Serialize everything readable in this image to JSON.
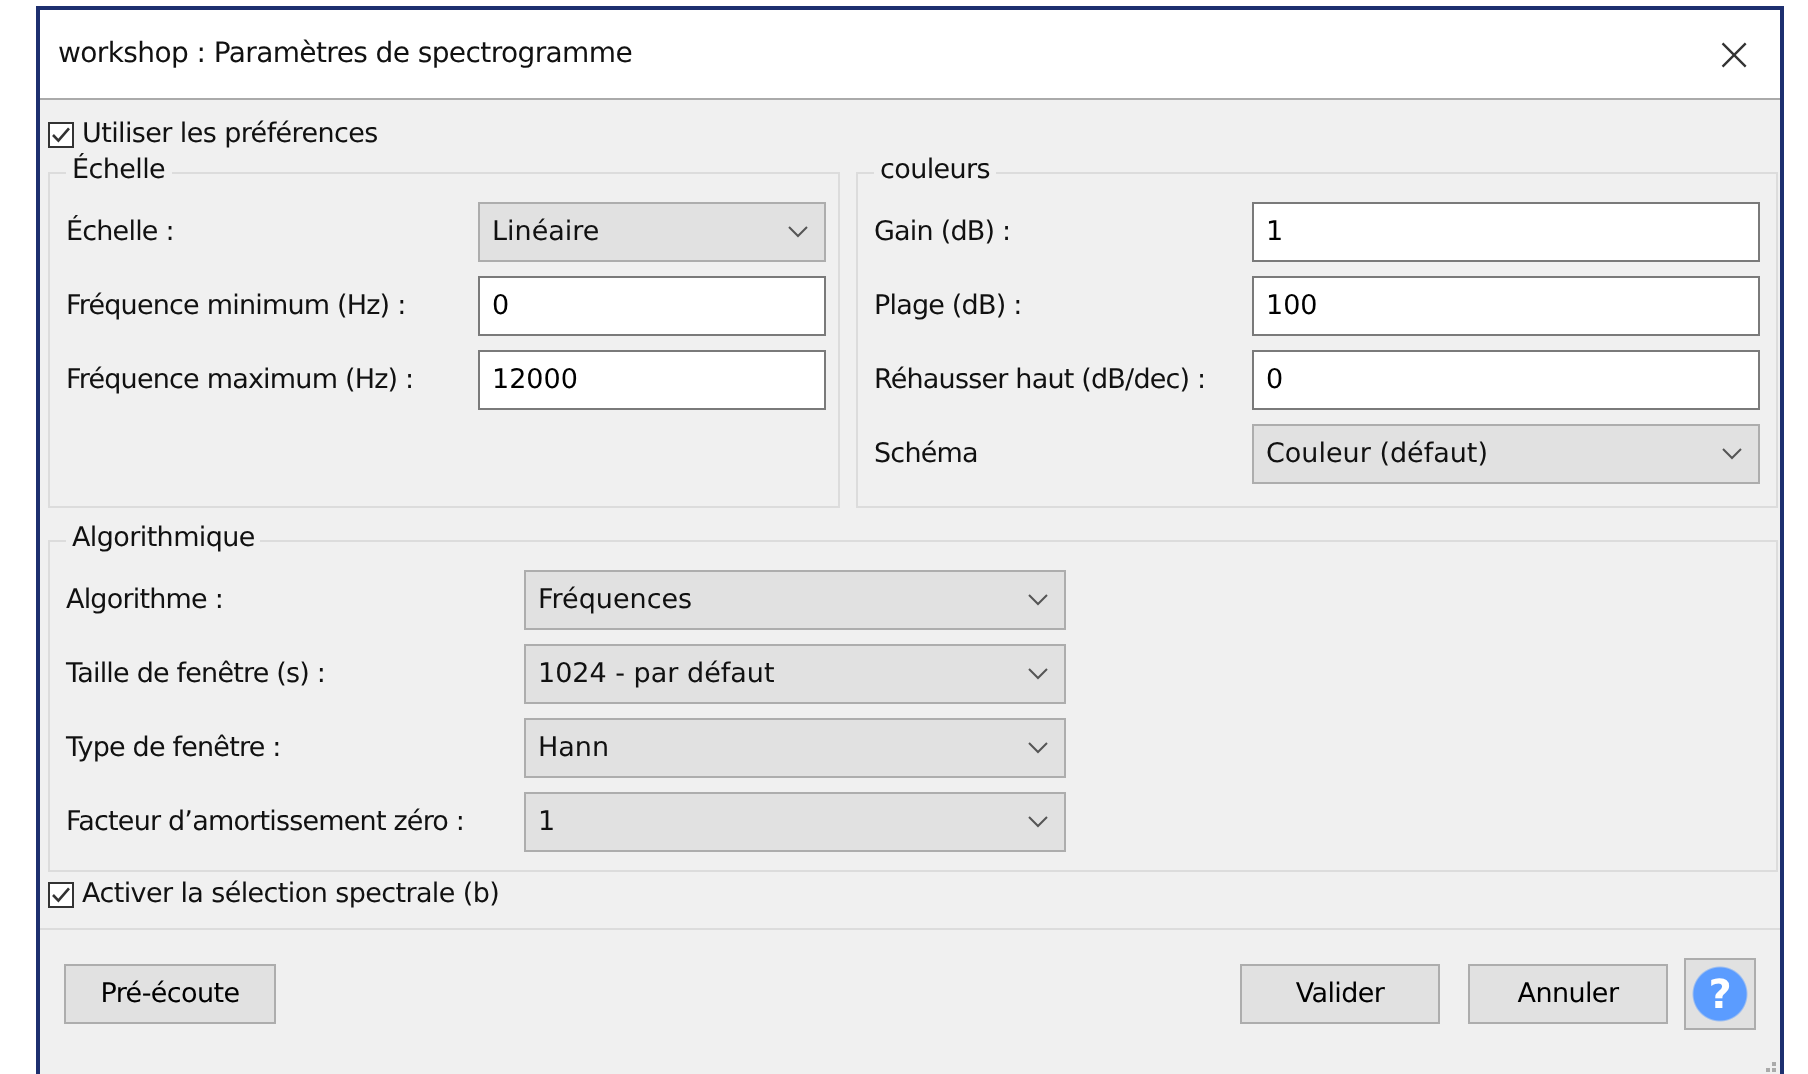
{
  "window": {
    "title": "workshop : Paramètres de spectrogramme",
    "close": "×"
  },
  "use_preferences": {
    "label": "Utiliser les préférences",
    "checked": true
  },
  "groups": [
    {
      "title": "Échelle",
      "fields": [
        {
          "label": "Échelle :",
          "kind": "dropdown",
          "value": "Linéaire"
        },
        {
          "label": "Fréquence minimum (Hz) :",
          "kind": "input",
          "value": "0"
        },
        {
          "label": "Fréquence maximum (Hz) :",
          "kind": "input",
          "value": "12000"
        }
      ]
    },
    {
      "title": "couleurs",
      "fields": [
        {
          "label": "Gain (dB) :",
          "kind": "input",
          "value": "1"
        },
        {
          "label": "Plage (dB) :",
          "kind": "input",
          "value": "100"
        },
        {
          "label": "Réhausser haut (dB/dec) :",
          "kind": "input",
          "value": "0"
        },
        {
          "label": "Schéma",
          "kind": "dropdown",
          "value": "Couleur (défaut)"
        }
      ]
    },
    {
      "title": "Algorithmique",
      "fields": [
        {
          "label": "Algorithme :",
          "kind": "dropdown",
          "value": "Fréquences"
        },
        {
          "label": "Taille de fenêtre (s) :",
          "kind": "dropdown",
          "value": "1024 - par défaut"
        },
        {
          "label": "Type de fenêtre :",
          "kind": "dropdown",
          "value": "Hann"
        },
        {
          "label": "Facteur d’amortissement zéro :",
          "kind": "dropdown",
          "value": "1"
        }
      ]
    }
  ],
  "spectral_selection": {
    "label": "Activer la sélection spectrale (b)",
    "checked": true
  },
  "buttons": [
    {
      "label": "Pré-écoute"
    },
    {
      "label": "Valider"
    },
    {
      "label": "Annuler"
    }
  ],
  "help_button": {
    "label": "?"
  }
}
